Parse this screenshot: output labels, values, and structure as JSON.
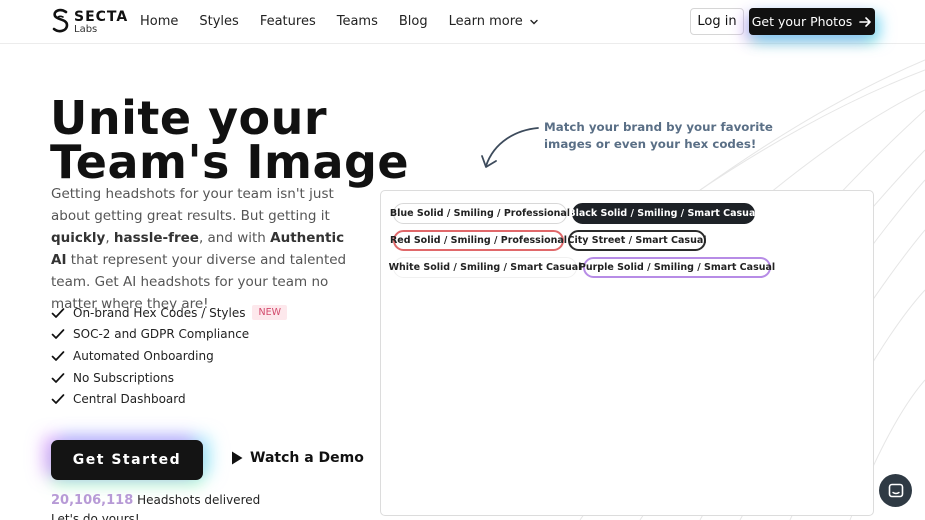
{
  "brand": {
    "name": "SECTA",
    "sub": "Labs"
  },
  "nav": {
    "items": [
      "Home",
      "Styles",
      "Features",
      "Teams",
      "Blog"
    ],
    "learn_more": "Learn more"
  },
  "header": {
    "login_label": "Log in",
    "cta_label": "Get your Photos"
  },
  "hero": {
    "title_line1": "Unite your",
    "title_line2": "Team's Image",
    "desc_part1": "Getting headshots for your team isn't just about getting great results. But getting it ",
    "desc_bold1": "quickly",
    "desc_part2": ", ",
    "desc_bold2": "hassle-free",
    "desc_part3": ", and with ",
    "desc_bold3": "Authentic AI",
    "desc_part4": " that represent your diverse and talented team. Get AI headshots for your team no matter where they are!"
  },
  "features": [
    {
      "label": "On-brand Hex Codes / Styles",
      "badge": "NEW"
    },
    {
      "label": "SOC-2 and GDPR Compliance"
    },
    {
      "label": "Automated Onboarding"
    },
    {
      "label": "No Subscriptions"
    },
    {
      "label": "Central Dashboard"
    }
  ],
  "actions": {
    "get_started": "Get Started",
    "watch_demo": "Watch a Demo"
  },
  "stats": {
    "count": "20,106,118",
    "label": " Headshots delivered",
    "sub": "Let's do yours!"
  },
  "brand_note": "Match your brand by your favorite images or even your hex codes!",
  "tags": [
    "Blue Solid / Smiling / Professional",
    "Black Solid / Smiling / Smart Casual",
    "Red Solid / Smiling / Professional",
    "City Street / Smart Casual",
    "White Solid / Smiling / Smart Casual",
    "Purple Solid / Smiling / Smart Casual"
  ],
  "colors": {
    "accent_dark": "#111111",
    "stat_purple": "#b79ad6",
    "badge_bg": "#fde8ec",
    "badge_text": "#d24a6c",
    "note_text": "#5a6f86"
  },
  "icons": {
    "logo": "secta-s-logo-icon",
    "chevron": "chevron-down-icon",
    "arrow": "arrow-right-icon",
    "check": "check-icon",
    "play": "play-icon",
    "curved_arrow": "curved-arrow-icon",
    "chat": "chat-icon"
  }
}
